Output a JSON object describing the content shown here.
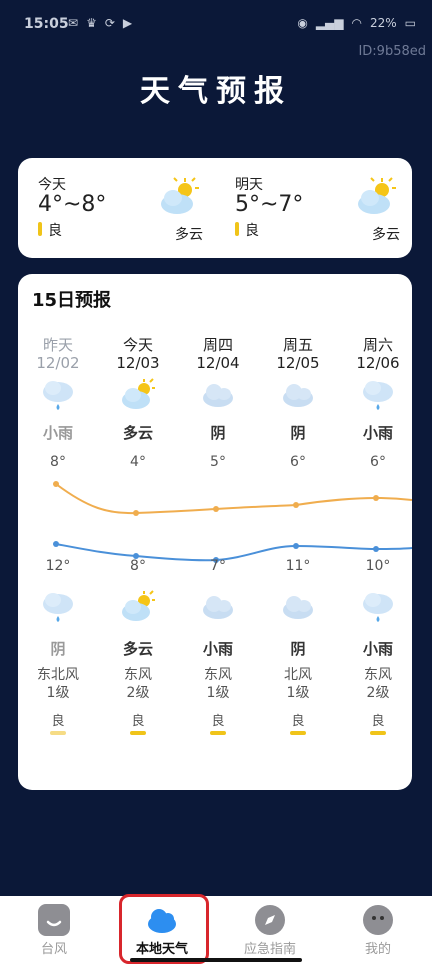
{
  "status_bar": {
    "time": "15:05",
    "battery": "22%"
  },
  "id_tag": "ID:9b58ed",
  "page_title": "天气预报",
  "today_card": {
    "days": [
      {
        "name": "今天",
        "temp": "4°~8°",
        "aqi": "良",
        "condition": "多云",
        "icon": "partly-cloudy-icon"
      },
      {
        "name": "明天",
        "temp": "5°~7°",
        "aqi": "良",
        "condition": "多云",
        "icon": "partly-cloudy-icon"
      }
    ]
  },
  "forecast": {
    "title": "15日预报",
    "days": [
      {
        "weekday": "昨天",
        "date": "12/02",
        "day_cond": "小雨",
        "high": "8°",
        "low": "12°",
        "night_cond": "阴",
        "wind_dir": "东北风",
        "wind_level": "1级",
        "aqi": "良",
        "past": true,
        "day_icon": "rain-cloud-icon",
        "night_icon": "rain-cloud-icon"
      },
      {
        "weekday": "今天",
        "date": "12/03",
        "day_cond": "多云",
        "high": "4°",
        "low": "8°",
        "night_cond": "多云",
        "wind_dir": "东风",
        "wind_level": "2级",
        "aqi": "良",
        "past": false,
        "day_icon": "partly-cloudy-icon",
        "night_icon": "partly-cloudy-icon"
      },
      {
        "weekday": "周四",
        "date": "12/04",
        "day_cond": "阴",
        "high": "5°",
        "low": "7°",
        "night_cond": "小雨",
        "wind_dir": "东风",
        "wind_level": "1级",
        "aqi": "良",
        "past": false,
        "day_icon": "cloud-icon",
        "night_icon": "cloud-icon"
      },
      {
        "weekday": "周五",
        "date": "12/05",
        "day_cond": "阴",
        "high": "6°",
        "low": "11°",
        "night_cond": "阴",
        "wind_dir": "北风",
        "wind_level": "1级",
        "aqi": "良",
        "past": false,
        "day_icon": "cloud-icon",
        "night_icon": "cloud-icon"
      },
      {
        "weekday": "周六",
        "date": "12/06",
        "day_cond": "小雨",
        "high": "6°",
        "low": "10°",
        "night_cond": "小雨",
        "wind_dir": "东风",
        "wind_level": "2级",
        "aqi": "良",
        "past": false,
        "day_icon": "rain-cloud-icon",
        "night_icon": "rain-cloud-icon"
      }
    ],
    "line_colors": {
      "high": "#f0ad4e",
      "low": "#4a90d9"
    }
  },
  "tabbar": {
    "tabs": [
      {
        "label": "台风",
        "icon": "typhoon-icon",
        "active": false
      },
      {
        "label": "本地天气",
        "icon": "cloud-icon",
        "active": true
      },
      {
        "label": "应急指南",
        "icon": "compass-icon",
        "active": false
      },
      {
        "label": "我的",
        "icon": "profile-icon",
        "active": false
      }
    ]
  },
  "colors": {
    "background": "#0b1838",
    "accent_blue": "#2d8ef0",
    "aqi_yellow": "#f0c419"
  }
}
